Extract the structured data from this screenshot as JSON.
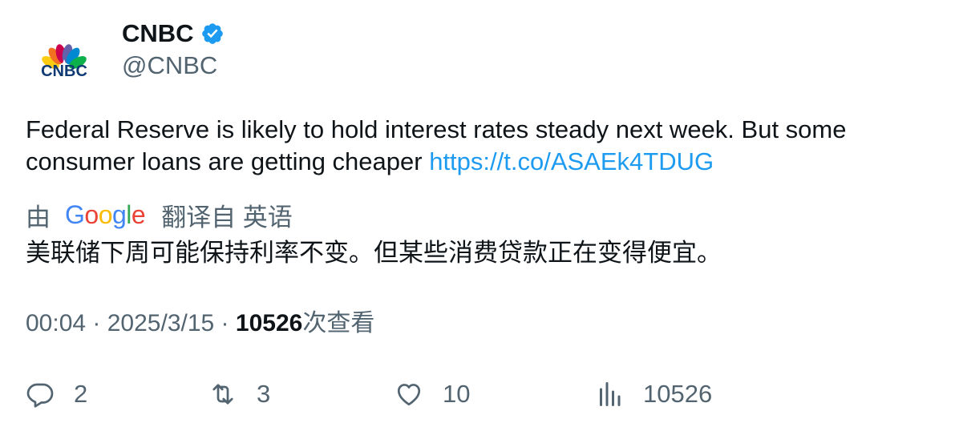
{
  "author": {
    "display_name": "CNBC",
    "handle": "@CNBC",
    "verified_icon": "verified-badge-icon",
    "avatar": "cnbc-peacock-logo",
    "logo_text": "CNBC"
  },
  "tweet": {
    "text": "Federal Reserve is likely to hold interest rates steady next week. But some consumer loans are getting cheaper ",
    "link": "https://t.co/ASAEk4TDUG"
  },
  "translation": {
    "prefix": "由",
    "provider": "Google",
    "suffix": "翻译自 英语",
    "text": "美联储下周可能保持利率不变。但某些消费贷款正在变得便宜。"
  },
  "meta": {
    "time": "00:04",
    "separator": " · ",
    "date": "2025/3/15",
    "views_count": "10526",
    "views_label": "次查看"
  },
  "actions": {
    "replies": "2",
    "retweets": "3",
    "likes": "10",
    "views": "10526"
  },
  "colors": {
    "link": "#1d9bf0",
    "secondary_text": "#536471",
    "primary_text": "#0f1419",
    "verified": "#1d9bf0"
  }
}
